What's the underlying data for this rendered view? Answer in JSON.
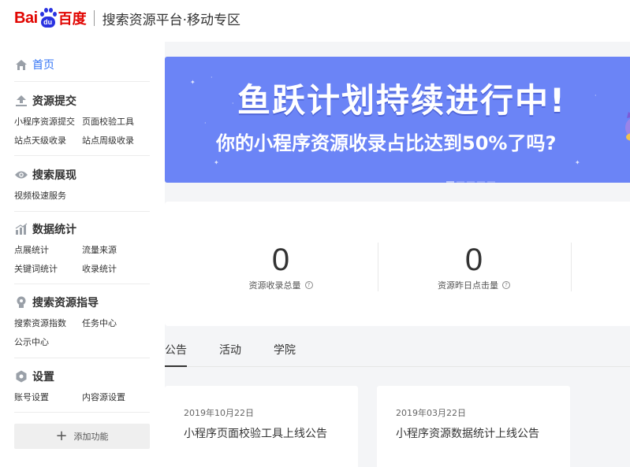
{
  "header": {
    "logo_bai": "Bai",
    "logo_du": "du",
    "logo_cn": "百度",
    "title": "搜索资源平台·移动专区"
  },
  "sidebar": {
    "home": "首页",
    "groups": [
      {
        "title": "资源提交",
        "icon": "upload-icon",
        "links": [
          "小程序资源提交",
          "页面校验工具",
          "站点天级收录",
          "站点周级收录"
        ]
      },
      {
        "title": "搜索展现",
        "icon": "eye-icon",
        "links": [
          "视频极速服务"
        ]
      },
      {
        "title": "数据统计",
        "icon": "bar-chart-icon",
        "links": [
          "点展统计",
          "流量来源",
          "关键词统计",
          "收录统计"
        ]
      },
      {
        "title": "搜索资源指导",
        "icon": "lightbulb-icon",
        "links": [
          "搜索资源指数",
          "任务中心",
          "公示中心"
        ]
      },
      {
        "title": "设置",
        "icon": "gear-icon",
        "links": [
          "账号设置",
          "内容源设置"
        ]
      }
    ],
    "add_button": "添加功能"
  },
  "banner": {
    "title": "鱼跃计划持续进行中!",
    "subtitle": "你的小程序资源收录占比达到50%了吗?"
  },
  "stats": [
    {
      "value": "0",
      "label": "资源收录总量"
    },
    {
      "value": "0",
      "label": "资源昨日点击量"
    }
  ],
  "tabs": [
    "公告",
    "活动",
    "学院"
  ],
  "notices": [
    {
      "date": "2019年10月22日",
      "title": "小程序页面校验工具上线公告"
    },
    {
      "date": "2019年03月22日",
      "title": "小程序资源数据统计上线公告"
    }
  ],
  "colors": {
    "brand_red": "#e10602",
    "brand_blue": "#2932e1",
    "accent": "#3475f5",
    "banner_bg": "#6b84f6"
  }
}
